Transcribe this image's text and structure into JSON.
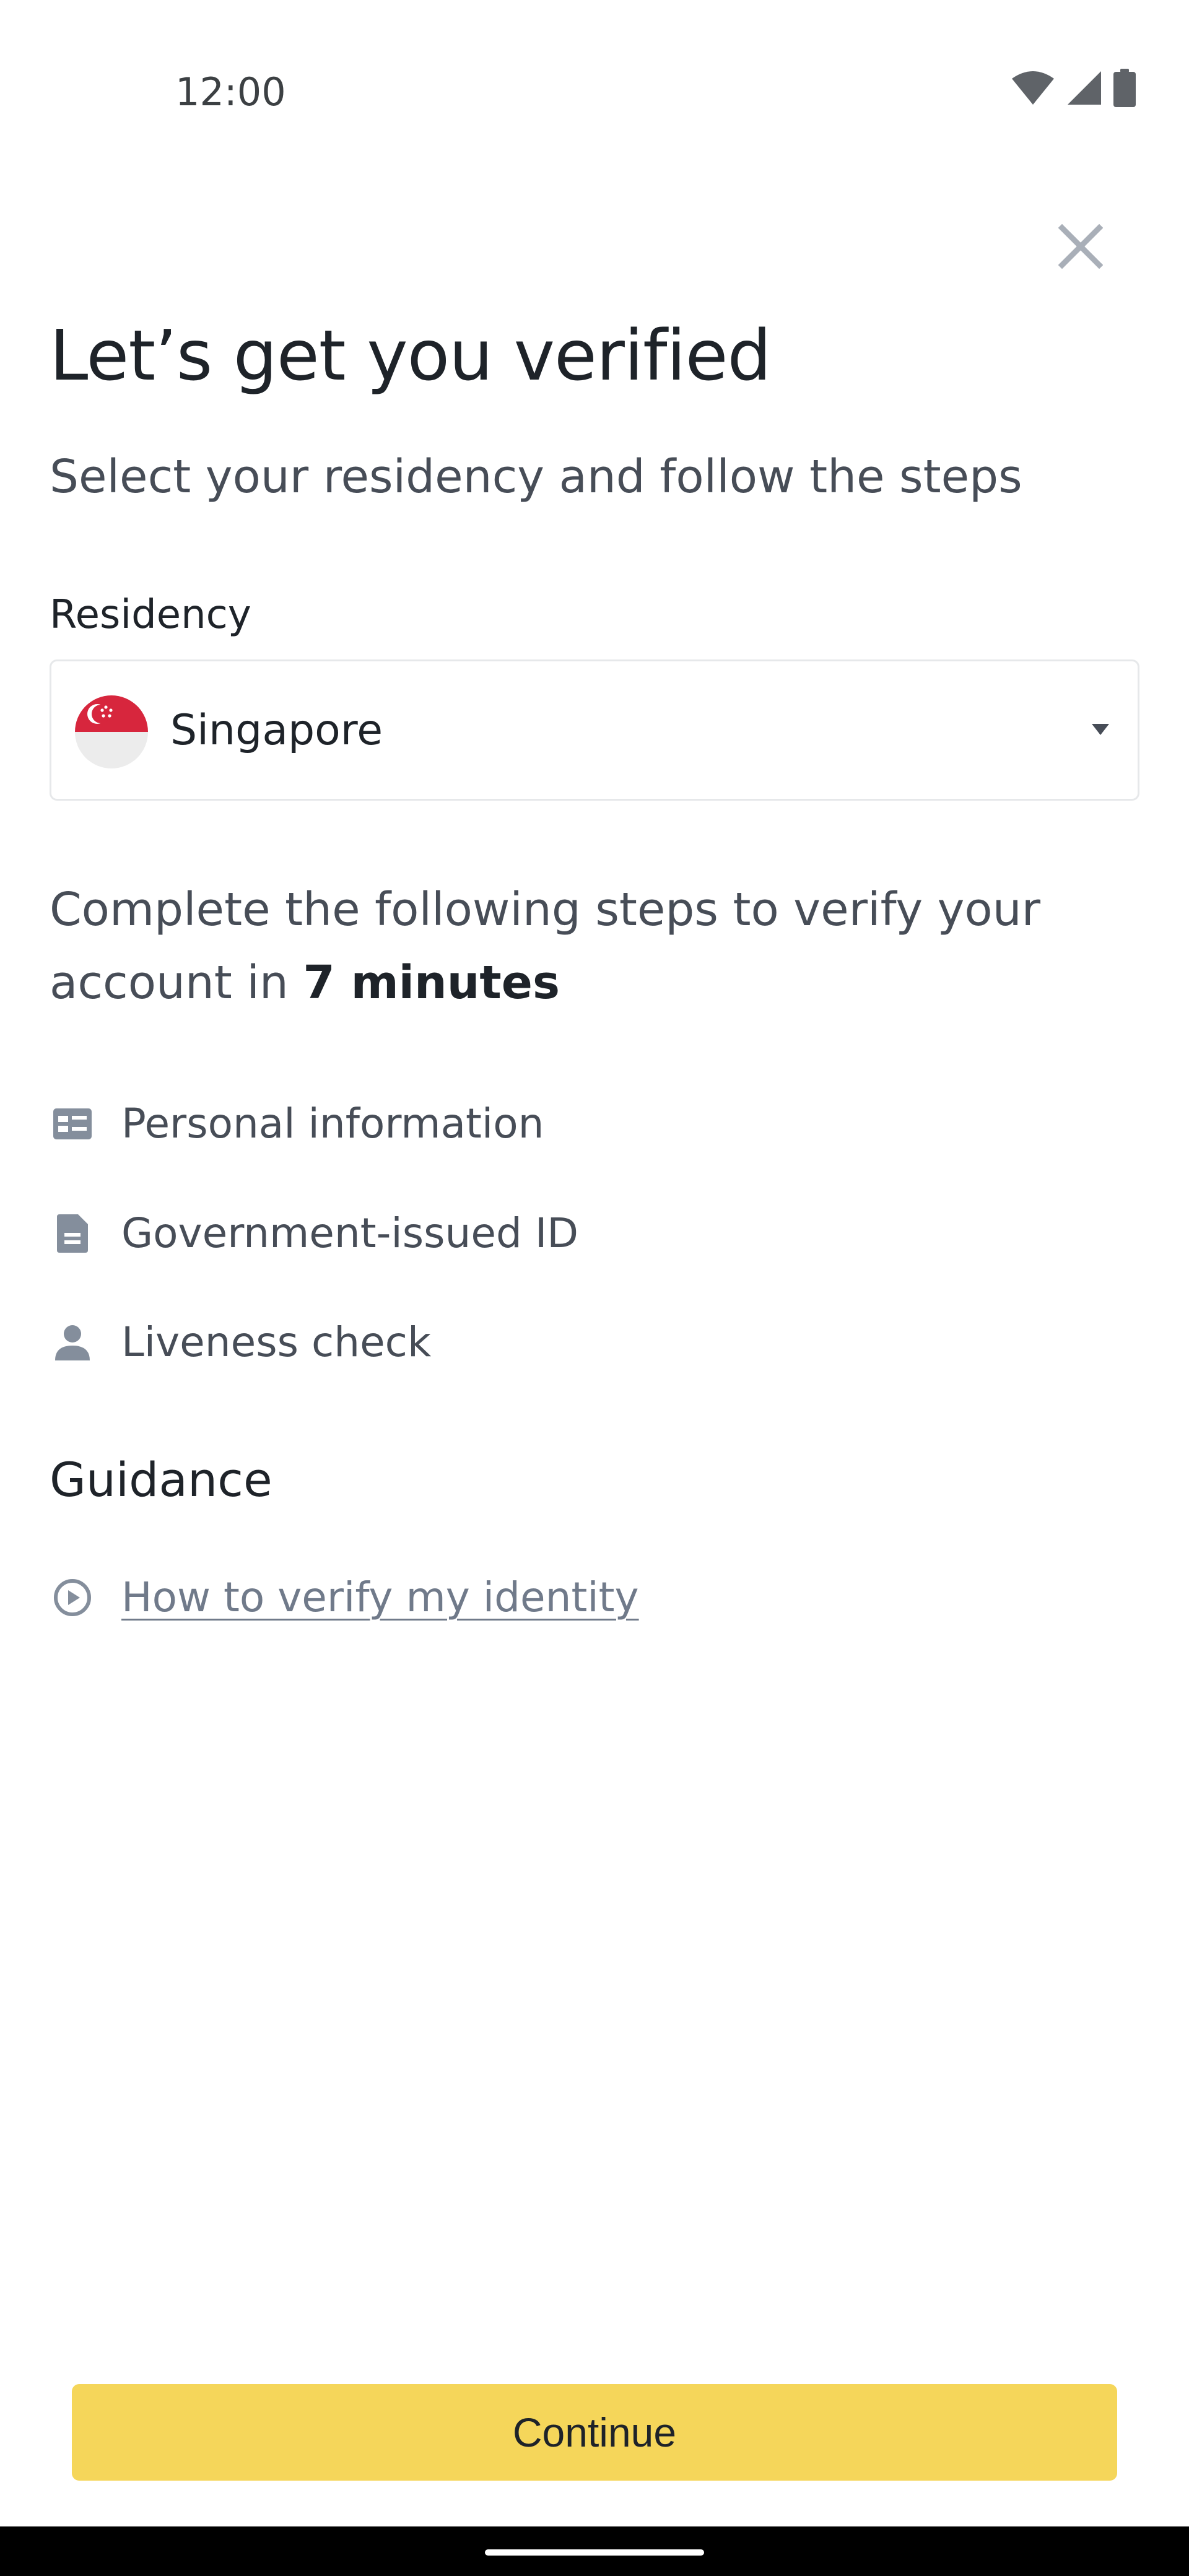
{
  "status_bar": {
    "time": "12:00",
    "icons": [
      "wifi-icon",
      "cellular-signal-icon",
      "battery-icon"
    ]
  },
  "header": {
    "close_icon": "close-icon",
    "title": "Let’s get you verified",
    "subtitle": "Select your residency and follow the steps"
  },
  "residency": {
    "label": "Residency",
    "selected_value": "Singapore",
    "flag_icon": "singapore-flag-icon",
    "dropdown_icon": "caret-down-icon"
  },
  "steps": {
    "intro_prefix": "Complete the following steps to verify your account in ",
    "intro_emphasis": "7 minutes",
    "items": [
      {
        "label": "Personal information",
        "icon": "id-card-icon"
      },
      {
        "label": "Government-issued ID",
        "icon": "document-icon"
      },
      {
        "label": "Liveness check",
        "icon": "person-icon"
      }
    ]
  },
  "guidance": {
    "heading": "Guidance",
    "link_label": "How to verify my identity",
    "link_icon": "play-circle-icon"
  },
  "footer": {
    "continue_label": "Continue"
  },
  "colors": {
    "accent": "#F5D65A",
    "text_primary": "#1E2329",
    "text_secondary": "#474D57",
    "icon_gray": "#707A8A",
    "border": "#E6E8EA",
    "flag_red": "#D7263D"
  }
}
